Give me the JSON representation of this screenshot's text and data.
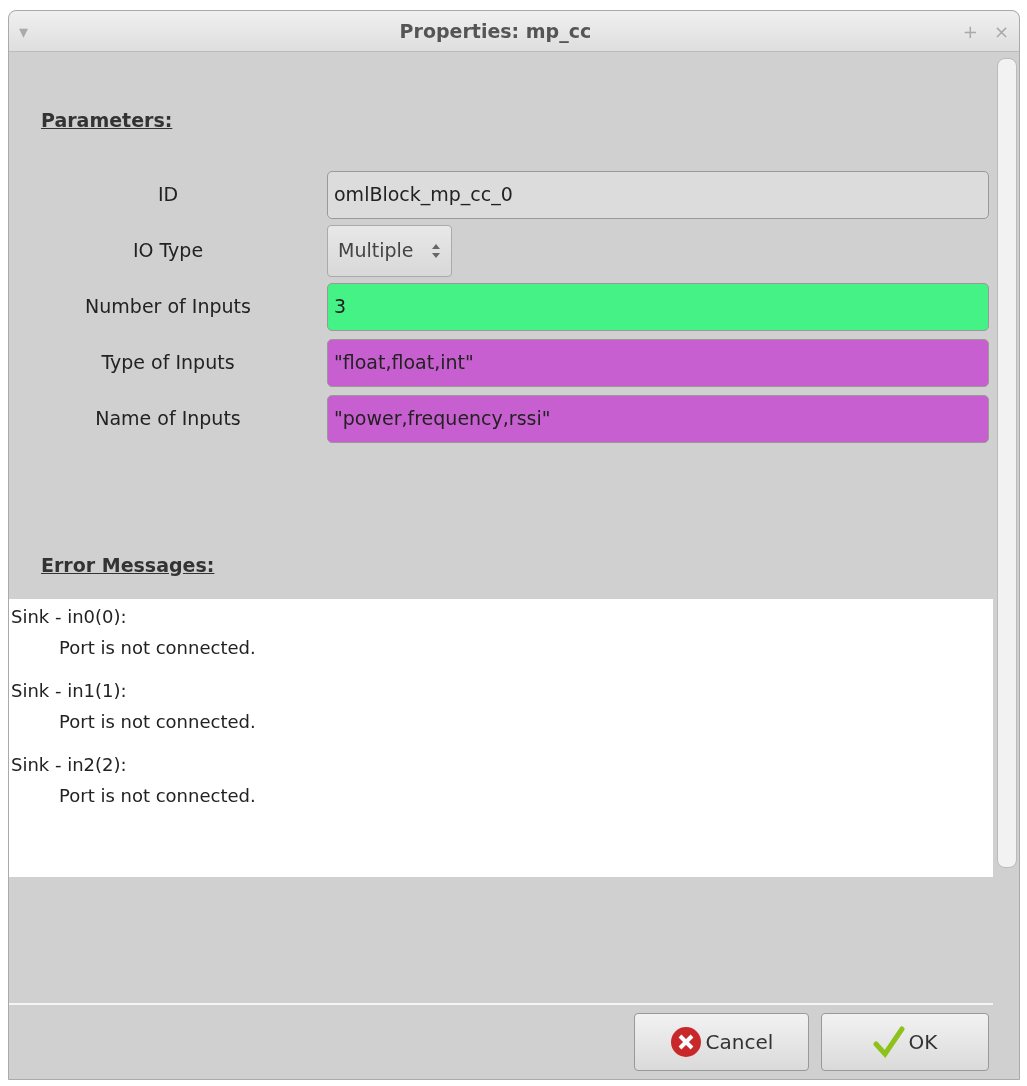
{
  "window": {
    "title": "Properties: mp_cc",
    "menu_glyph": "▾",
    "pin_glyph": "+",
    "close_glyph": "×"
  },
  "parameters": {
    "heading": "Parameters:",
    "fields": [
      {
        "label": "ID",
        "kind": "text",
        "value": "omlBlock_mp_cc_0",
        "color": "#dcdcdc"
      },
      {
        "label": "IO Type",
        "kind": "spin",
        "value": "Multiple"
      },
      {
        "label": "Number of Inputs",
        "kind": "text",
        "value": "3",
        "color": "#44f286"
      },
      {
        "label": "Type of Inputs",
        "kind": "text",
        "value": "\"float,float,int\"",
        "color": "#c85fd0"
      },
      {
        "label": "Name of Inputs",
        "kind": "text",
        "value": "\"power,frequency,rssi\"",
        "color": "#c85fd0"
      }
    ]
  },
  "errors": {
    "heading": "Error Messages:",
    "messages": [
      {
        "source": "Sink - in0(0):",
        "text": "Port is not connected."
      },
      {
        "source": "Sink - in1(1):",
        "text": "Port is not connected."
      },
      {
        "source": "Sink - in2(2):",
        "text": "Port is not connected."
      }
    ]
  },
  "buttons": [
    {
      "label": "Cancel",
      "kind": "cancel"
    },
    {
      "label": "OK",
      "kind": "ok"
    }
  ]
}
